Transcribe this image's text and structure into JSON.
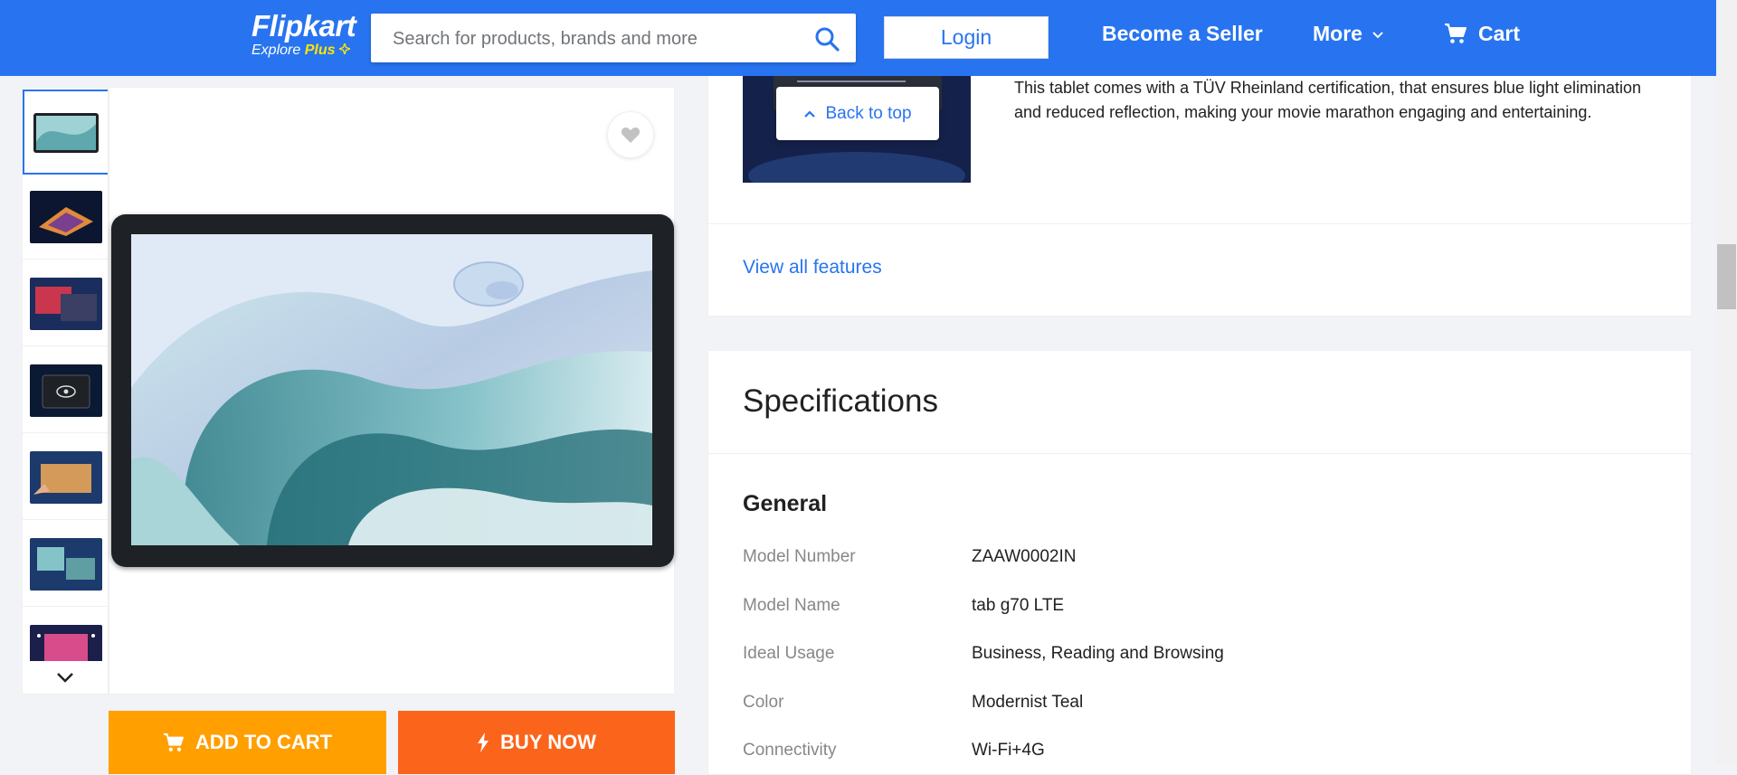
{
  "header": {
    "logo_word": "Flipkart",
    "logo_explore": "Explore",
    "logo_plus": "Plus",
    "search_placeholder": "Search for products, brands and more",
    "login_label": "Login",
    "seller_label": "Become a Seller",
    "more_label": "More",
    "cart_label": "Cart",
    "brand_color": "#2874f0",
    "plus_color": "#ffe500"
  },
  "gallery": {
    "thumbnails": [
      "tablet-front",
      "tablet-side",
      "tablet-dual",
      "tablet-eye-care",
      "tablet-hands",
      "tablet-stand",
      "tablet-colorful"
    ],
    "selected_index": 0
  },
  "actions": {
    "add_to_cart_label": "ADD TO CART",
    "buy_now_label": "BUY NOW",
    "add_to_cart_color": "#ff9f00",
    "buy_now_color": "#fb641b"
  },
  "features": {
    "text": "This tablet comes with a TÜV Rheinland certification, that ensures blue light elimination and reduced reflection, making your movie marathon engaging and entertaining.",
    "view_all_label": "View all features",
    "back_to_top_label": "Back to top"
  },
  "specifications": {
    "title": "Specifications",
    "group": "General",
    "rows": [
      {
        "key": "Model Number",
        "value": "ZAAW0002IN"
      },
      {
        "key": "Model Name",
        "value": "tab g70 LTE"
      },
      {
        "key": "Ideal Usage",
        "value": "Business, Reading and Browsing"
      },
      {
        "key": "Color",
        "value": "Modernist Teal"
      },
      {
        "key": "Connectivity",
        "value": "Wi-Fi+4G"
      }
    ]
  }
}
